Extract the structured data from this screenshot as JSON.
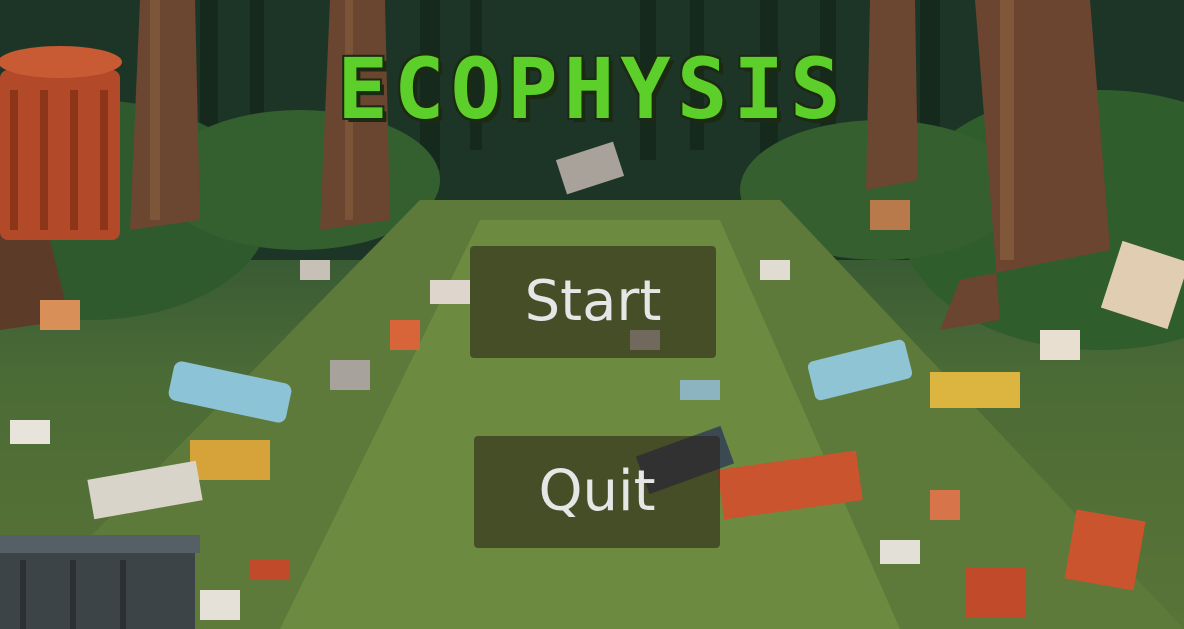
{
  "game": {
    "title": "ECOPHYSIS"
  },
  "menu": {
    "start_label": "Start",
    "quit_label": "Quit"
  },
  "colors": {
    "title_green": "#5ccf2a",
    "title_outline": "#1c2a12",
    "button_bg": "rgba(40,30,20,0.55)",
    "button_text": "#e6e6e6"
  }
}
